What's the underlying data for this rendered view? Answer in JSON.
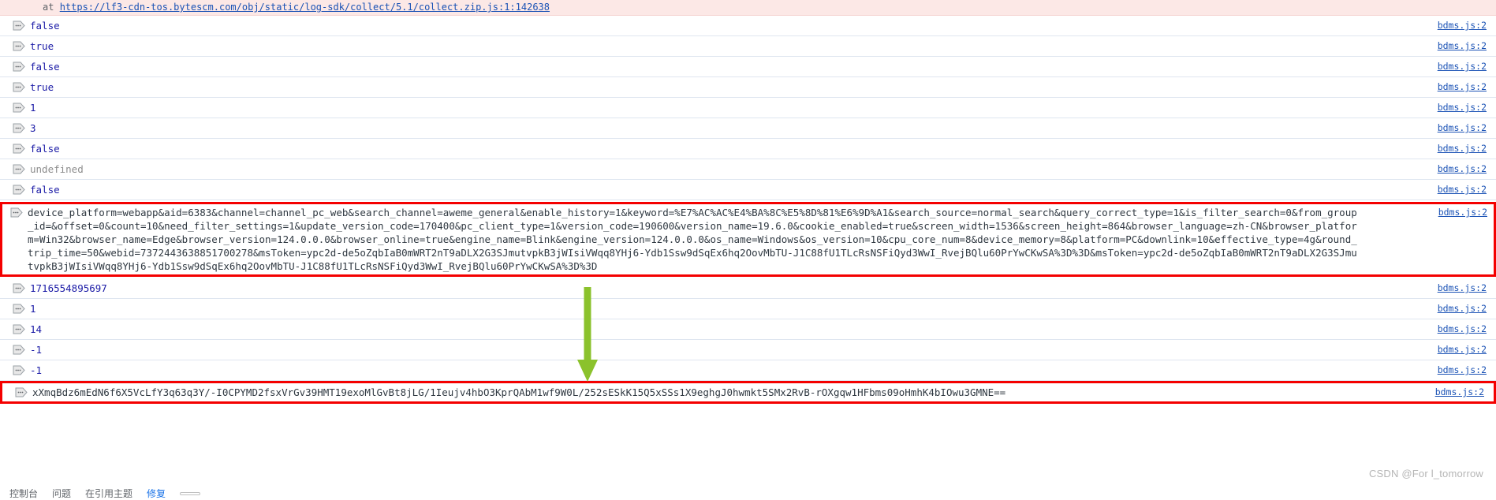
{
  "error_stack": {
    "prefix": "at",
    "url": "https://lf3-cdn-tos.bytescm.com/obj/static/log-sdk/collect/5.1/collect.zip.js:1:142638"
  },
  "source_link": "bdms.js:2",
  "icons": {
    "result": "result-arrow-icon",
    "annotation": "green-arrow-icon"
  },
  "colors": {
    "value_blue": "#1a1aa6",
    "link_blue": "#1a52b5",
    "undefined_gray": "#8c8c8c",
    "error_bg": "#fce8e6",
    "highlight_box": "#f40000",
    "annotation_arrow": "#8bc22c"
  },
  "console_rows": [
    {
      "value": "false",
      "kind": "bool",
      "source": "bdms.js:2",
      "boxed": false
    },
    {
      "value": "true",
      "kind": "bool",
      "source": "bdms.js:2",
      "boxed": false
    },
    {
      "value": "false",
      "kind": "bool",
      "source": "bdms.js:2",
      "boxed": false
    },
    {
      "value": "true",
      "kind": "bool",
      "source": "bdms.js:2",
      "boxed": false
    },
    {
      "value": "1",
      "kind": "num",
      "source": "bdms.js:2",
      "boxed": false
    },
    {
      "value": "3",
      "kind": "num",
      "source": "bdms.js:2",
      "boxed": false
    },
    {
      "value": "false",
      "kind": "bool",
      "source": "bdms.js:2",
      "boxed": false
    },
    {
      "value": "undefined",
      "kind": "undef",
      "source": "bdms.js:2",
      "boxed": false
    },
    {
      "value": "false",
      "kind": "bool",
      "source": "bdms.js:2",
      "boxed": false
    },
    {
      "value": "device_platform=webapp&aid=6383&channel=channel_pc_web&search_channel=aweme_general&enable_history=1&keyword=%E7%AC%AC%E4%BA%8C%E5%8D%81%E6%9D%A1&search_source=normal_search&query_correct_type=1&is_filter_search=0&from_group_id=&offset=0&count=10&need_filter_settings=1&update_version_code=170400&pc_client_type=1&version_code=190600&version_name=19.6.0&cookie_enabled=true&screen_width=1536&screen_height=864&browser_language=zh-CN&browser_platform=Win32&browser_name=Edge&browser_version=124.0.0.0&browser_online=true&engine_name=Blink&engine_version=124.0.0.0&os_name=Windows&os_version=10&cpu_core_num=8&device_memory=8&platform=PC&downlink=10&effective_type=4g&round_trip_time=50&webid=7372443638851700278&msToken=ypc2d-de5oZqbIaB0mWRT2nT9aDLX2G3SJmutvpkB3jWIsiVWqq8YHj6-Ydb1Ssw9dSqEx6hq2OovMbTU-J1C88fU1TLcRsNSFiQyd3WwI_RvejBQlu60PrYwCKwSA%3D%3D&msToken=ypc2d-de5oZqbIaB0mWRT2nT9aDLX2G3SJmutvpkB3jWIsiVWqq8YHj6-Ydb1Ssw9dSqEx6hq2OovMbTU-J1C88fU1TLcRsNSFiQyd3WwI_RvejBQlu60PrYwCKwSA%3D%3D",
      "kind": "str",
      "source": "bdms.js:2",
      "boxed": true
    },
    {
      "value": "1716554895697",
      "kind": "num",
      "source": "bdms.js:2",
      "boxed": false
    },
    {
      "value": "1",
      "kind": "num",
      "source": "bdms.js:2",
      "boxed": false
    },
    {
      "value": "14",
      "kind": "num",
      "source": "bdms.js:2",
      "boxed": false
    },
    {
      "value": "-1",
      "kind": "num",
      "source": "bdms.js:2",
      "boxed": false
    },
    {
      "value": "-1",
      "kind": "num",
      "source": "bdms.js:2",
      "boxed": false
    },
    {
      "value": "xXmqBdz6mEdN6f6X5VcLfY3q63q3Y/-I0CPYMD2fsxVrGv39HMT19exoMlGvBt8jLG/1Ieujv4hbO3KprQAbM1wf9W0L/252sESkK15Q5xSSs1X9eghgJ0hwmkt5SMx2RvB-rOXgqw1HFbms09oHmhK4bIOwu3GMNE==",
      "kind": "str",
      "source": "bdms.js:2",
      "boxed": true
    }
  ],
  "watermark": "CSDN @For l_tomorrow",
  "bottom_bar": {
    "item1": "控制台",
    "item2": "问题",
    "item3": "在引用主题",
    "link": "修复",
    "box": ""
  }
}
